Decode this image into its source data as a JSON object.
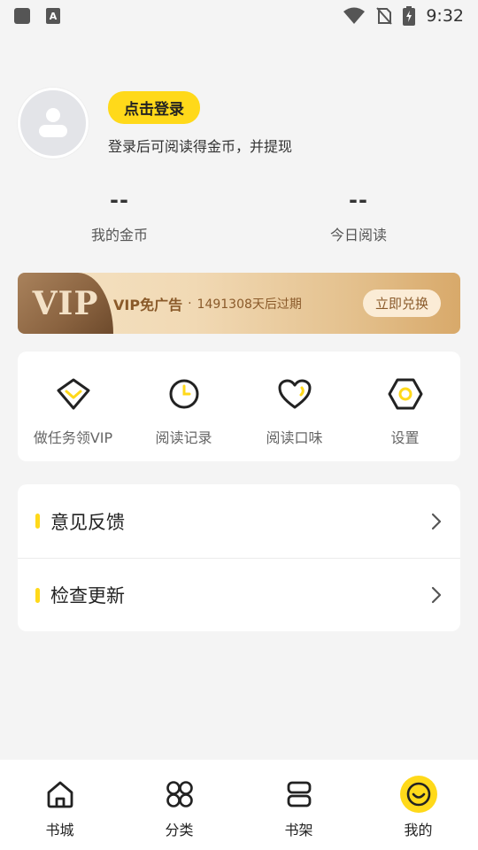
{
  "status_bar": {
    "time": "9:32",
    "icons": [
      "notification-square-icon",
      "keyboard-a-icon",
      "wifi-icon",
      "no-sim-icon",
      "battery-charging-icon"
    ]
  },
  "profile": {
    "login_label": "点击登录",
    "description": "登录后可阅读得金币，并提现"
  },
  "stats": [
    {
      "value": "--",
      "label": "我的金币"
    },
    {
      "value": "--",
      "label": "今日阅读"
    }
  ],
  "vip": {
    "badge": "VIP",
    "title": "VIP免广告",
    "separator": "·",
    "expire": "1491308天后过期",
    "button": "立即兑换"
  },
  "quick_actions": [
    {
      "label": "做任务领VIP",
      "icon": "vip-gem-icon"
    },
    {
      "label": "阅读记录",
      "icon": "clock-icon"
    },
    {
      "label": "阅读口味",
      "icon": "heart-icon"
    },
    {
      "label": "设置",
      "icon": "hexagon-settings-icon"
    }
  ],
  "menu": [
    {
      "label": "意见反馈"
    },
    {
      "label": "检查更新"
    }
  ],
  "bottom_nav": [
    {
      "label": "书城",
      "icon": "home-icon"
    },
    {
      "label": "分类",
      "icon": "grid-icon"
    },
    {
      "label": "书架",
      "icon": "bookshelf-icon"
    },
    {
      "label": "我的",
      "icon": "smile-icon",
      "active": true
    }
  ],
  "colors": {
    "accent": "#ffd91a",
    "vip_text": "#8a5a2a"
  }
}
